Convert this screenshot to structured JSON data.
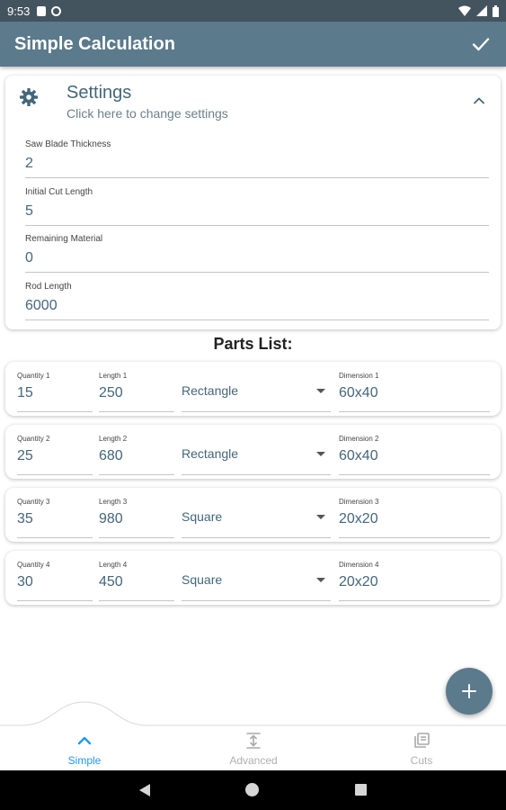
{
  "status_bar": {
    "time": "9:53"
  },
  "app_bar": {
    "title": "Simple Calculation"
  },
  "settings": {
    "title": "Settings",
    "subtitle": "Click here to change settings",
    "fields": [
      {
        "label": "Saw Blade Thickness",
        "value": "2"
      },
      {
        "label": "Initial Cut Length",
        "value": "5"
      },
      {
        "label": "Remaining Material",
        "value": "0"
      },
      {
        "label": "Rod Length",
        "value": "6000"
      }
    ]
  },
  "parts": {
    "title": "Parts List:",
    "items": [
      {
        "quantity_label": "Quantity 1",
        "quantity": "15",
        "length_label": "Length 1",
        "length": "250",
        "shape": "Rectangle",
        "dimension_label": "Dimension 1",
        "dimension": "60x40"
      },
      {
        "quantity_label": "Quantity 2",
        "quantity": "25",
        "length_label": "Length 2",
        "length": "680",
        "shape": "Rectangle",
        "dimension_label": "Dimension 2",
        "dimension": "60x40"
      },
      {
        "quantity_label": "Quantity 3",
        "quantity": "35",
        "length_label": "Length 3",
        "length": "980",
        "shape": "Square",
        "dimension_label": "Dimension 3",
        "dimension": "20x20"
      },
      {
        "quantity_label": "Quantity 4",
        "quantity": "30",
        "length_label": "Length 4",
        "length": "450",
        "shape": "Square",
        "dimension_label": "Dimension 4",
        "dimension": "20x20"
      }
    ]
  },
  "bottom_nav": {
    "items": [
      {
        "label": "Simple",
        "icon": "chevron-up-icon",
        "active": true
      },
      {
        "label": "Advanced",
        "icon": "height-icon",
        "active": false
      },
      {
        "label": "Cuts",
        "icon": "library-icon",
        "active": false
      }
    ]
  },
  "colors": {
    "app_bar": "#5b7a8c",
    "status_bar": "#44545f",
    "accent": "#2196f3",
    "value_text": "#44667a"
  }
}
